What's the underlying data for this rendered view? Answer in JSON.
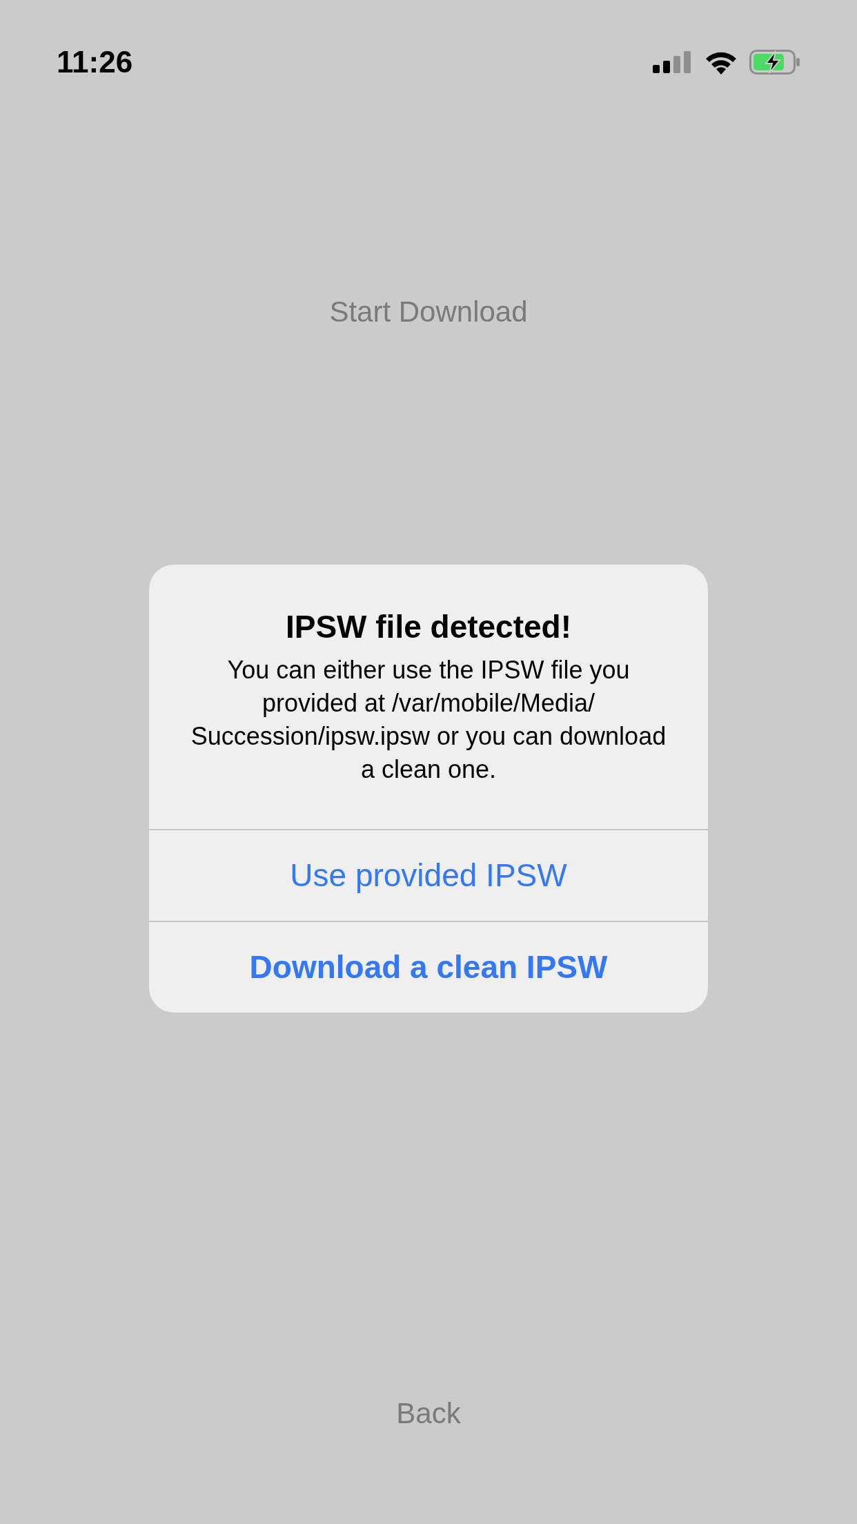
{
  "status_bar": {
    "time": "11:26"
  },
  "start_button": "Start Download",
  "alert": {
    "title": "IPSW file detected!",
    "message": "You can either use the IPSW file you provided at /var/mobile/Media/ Succession/ipsw.ipsw or you can download a clean one.",
    "actions": [
      {
        "label": "Use provided IPSW",
        "preferred": false
      },
      {
        "label": "Download a clean IPSW",
        "preferred": true
      }
    ]
  },
  "back_button": "Back"
}
